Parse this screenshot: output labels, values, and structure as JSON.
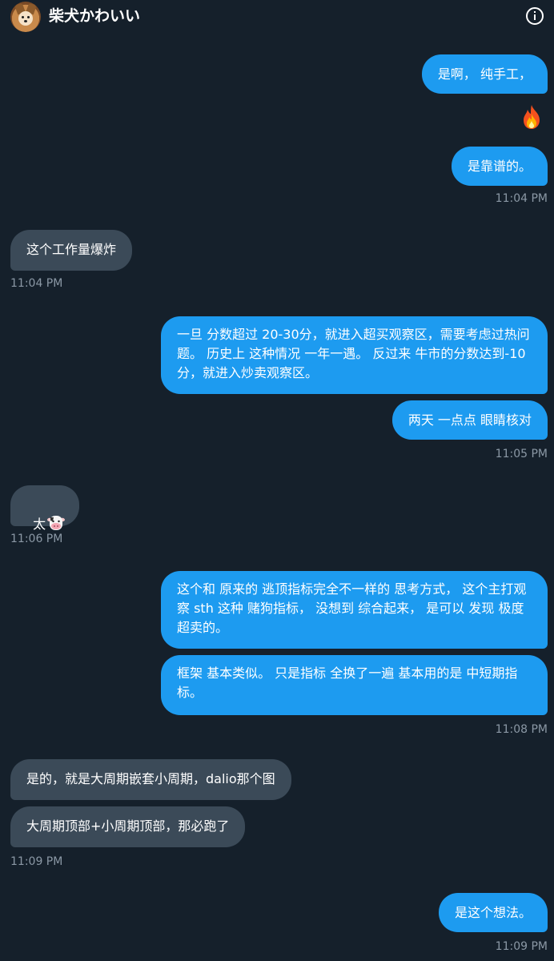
{
  "header": {
    "contact_name": "柴犬かわいい",
    "avatar_icon": "shiba-avatar",
    "info_icon": "info-icon"
  },
  "messages": [
    {
      "dir": "out",
      "text": "是啊， 纯手工，"
    },
    {
      "dir": "out",
      "emoji": "fire"
    },
    {
      "dir": "out",
      "text": "是靠谱的。"
    },
    {
      "time": "11:04 PM"
    },
    {
      "dir": "in",
      "text": "这个工作量爆炸"
    },
    {
      "time": "11:04 PM"
    },
    {
      "dir": "out",
      "text": "一旦 分数超过 20-30分，就进入超买观察区，需要考虑过热问题。 历史上 这种情况 一年一遇。 反过来 牛市的分数达到-10分，就进入炒卖观察区。"
    },
    {
      "dir": "out",
      "text": "两天 一点点 眼睛核对"
    },
    {
      "time": "11:05 PM"
    },
    {
      "dir": "in",
      "text": "太",
      "emoji": "cow"
    },
    {
      "time": "11:06 PM"
    },
    {
      "dir": "out",
      "text": "这个和 原来的 逃顶指标完全不一样的 思考方式， 这个主打观察 sth 这种 赌狗指标， 没想到 综合起来， 是可以 发现 极度超卖的。"
    },
    {
      "dir": "out",
      "text": "框架 基本类似。 只是指标 全换了一遍 基本用的是 中短期指标。"
    },
    {
      "time": "11:08 PM"
    },
    {
      "dir": "in",
      "text": "是的，就是大周期嵌套小周期，dalio那个图"
    },
    {
      "dir": "in",
      "text": "大周期顶部+小周期顶部，那必跑了"
    },
    {
      "time": "11:09 PM"
    },
    {
      "dir": "out",
      "text": "是这个想法。"
    },
    {
      "time": "11:09 PM"
    }
  ],
  "colors": {
    "background": "#15202b",
    "outgoing_bubble": "#1d9bf0",
    "incoming_bubble": "#3b4a58",
    "timestamp": "#8b98a5"
  }
}
